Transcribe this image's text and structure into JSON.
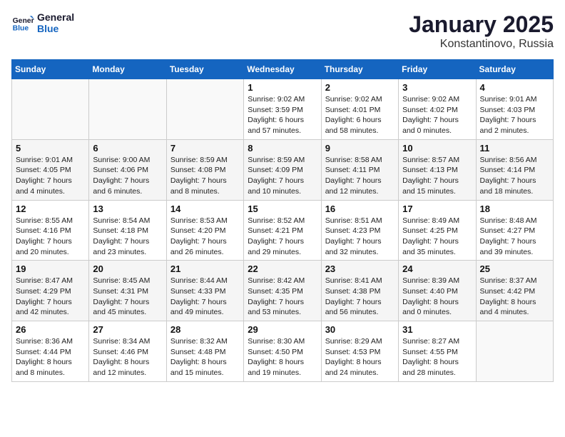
{
  "logo": {
    "line1": "General",
    "line2": "Blue"
  },
  "title": "January 2025",
  "subtitle": "Konstantinovo, Russia",
  "weekdays": [
    "Sunday",
    "Monday",
    "Tuesday",
    "Wednesday",
    "Thursday",
    "Friday",
    "Saturday"
  ],
  "weeks": [
    [
      {
        "day": "",
        "info": ""
      },
      {
        "day": "",
        "info": ""
      },
      {
        "day": "",
        "info": ""
      },
      {
        "day": "1",
        "info": "Sunrise: 9:02 AM\nSunset: 3:59 PM\nDaylight: 6 hours\nand 57 minutes."
      },
      {
        "day": "2",
        "info": "Sunrise: 9:02 AM\nSunset: 4:01 PM\nDaylight: 6 hours\nand 58 minutes."
      },
      {
        "day": "3",
        "info": "Sunrise: 9:02 AM\nSunset: 4:02 PM\nDaylight: 7 hours\nand 0 minutes."
      },
      {
        "day": "4",
        "info": "Sunrise: 9:01 AM\nSunset: 4:03 PM\nDaylight: 7 hours\nand 2 minutes."
      }
    ],
    [
      {
        "day": "5",
        "info": "Sunrise: 9:01 AM\nSunset: 4:05 PM\nDaylight: 7 hours\nand 4 minutes."
      },
      {
        "day": "6",
        "info": "Sunrise: 9:00 AM\nSunset: 4:06 PM\nDaylight: 7 hours\nand 6 minutes."
      },
      {
        "day": "7",
        "info": "Sunrise: 8:59 AM\nSunset: 4:08 PM\nDaylight: 7 hours\nand 8 minutes."
      },
      {
        "day": "8",
        "info": "Sunrise: 8:59 AM\nSunset: 4:09 PM\nDaylight: 7 hours\nand 10 minutes."
      },
      {
        "day": "9",
        "info": "Sunrise: 8:58 AM\nSunset: 4:11 PM\nDaylight: 7 hours\nand 12 minutes."
      },
      {
        "day": "10",
        "info": "Sunrise: 8:57 AM\nSunset: 4:13 PM\nDaylight: 7 hours\nand 15 minutes."
      },
      {
        "day": "11",
        "info": "Sunrise: 8:56 AM\nSunset: 4:14 PM\nDaylight: 7 hours\nand 18 minutes."
      }
    ],
    [
      {
        "day": "12",
        "info": "Sunrise: 8:55 AM\nSunset: 4:16 PM\nDaylight: 7 hours\nand 20 minutes."
      },
      {
        "day": "13",
        "info": "Sunrise: 8:54 AM\nSunset: 4:18 PM\nDaylight: 7 hours\nand 23 minutes."
      },
      {
        "day": "14",
        "info": "Sunrise: 8:53 AM\nSunset: 4:20 PM\nDaylight: 7 hours\nand 26 minutes."
      },
      {
        "day": "15",
        "info": "Sunrise: 8:52 AM\nSunset: 4:21 PM\nDaylight: 7 hours\nand 29 minutes."
      },
      {
        "day": "16",
        "info": "Sunrise: 8:51 AM\nSunset: 4:23 PM\nDaylight: 7 hours\nand 32 minutes."
      },
      {
        "day": "17",
        "info": "Sunrise: 8:49 AM\nSunset: 4:25 PM\nDaylight: 7 hours\nand 35 minutes."
      },
      {
        "day": "18",
        "info": "Sunrise: 8:48 AM\nSunset: 4:27 PM\nDaylight: 7 hours\nand 39 minutes."
      }
    ],
    [
      {
        "day": "19",
        "info": "Sunrise: 8:47 AM\nSunset: 4:29 PM\nDaylight: 7 hours\nand 42 minutes."
      },
      {
        "day": "20",
        "info": "Sunrise: 8:45 AM\nSunset: 4:31 PM\nDaylight: 7 hours\nand 45 minutes."
      },
      {
        "day": "21",
        "info": "Sunrise: 8:44 AM\nSunset: 4:33 PM\nDaylight: 7 hours\nand 49 minutes."
      },
      {
        "day": "22",
        "info": "Sunrise: 8:42 AM\nSunset: 4:35 PM\nDaylight: 7 hours\nand 53 minutes."
      },
      {
        "day": "23",
        "info": "Sunrise: 8:41 AM\nSunset: 4:38 PM\nDaylight: 7 hours\nand 56 minutes."
      },
      {
        "day": "24",
        "info": "Sunrise: 8:39 AM\nSunset: 4:40 PM\nDaylight: 8 hours\nand 0 minutes."
      },
      {
        "day": "25",
        "info": "Sunrise: 8:37 AM\nSunset: 4:42 PM\nDaylight: 8 hours\nand 4 minutes."
      }
    ],
    [
      {
        "day": "26",
        "info": "Sunrise: 8:36 AM\nSunset: 4:44 PM\nDaylight: 8 hours\nand 8 minutes."
      },
      {
        "day": "27",
        "info": "Sunrise: 8:34 AM\nSunset: 4:46 PM\nDaylight: 8 hours\nand 12 minutes."
      },
      {
        "day": "28",
        "info": "Sunrise: 8:32 AM\nSunset: 4:48 PM\nDaylight: 8 hours\nand 15 minutes."
      },
      {
        "day": "29",
        "info": "Sunrise: 8:30 AM\nSunset: 4:50 PM\nDaylight: 8 hours\nand 19 minutes."
      },
      {
        "day": "30",
        "info": "Sunrise: 8:29 AM\nSunset: 4:53 PM\nDaylight: 8 hours\nand 24 minutes."
      },
      {
        "day": "31",
        "info": "Sunrise: 8:27 AM\nSunset: 4:55 PM\nDaylight: 8 hours\nand 28 minutes."
      },
      {
        "day": "",
        "info": ""
      }
    ]
  ]
}
